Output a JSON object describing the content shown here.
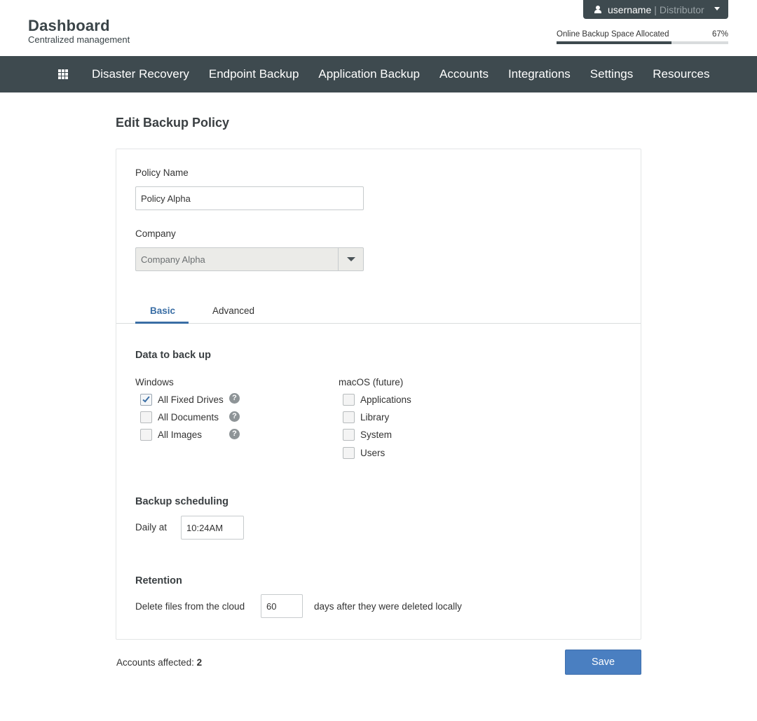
{
  "brand": {
    "title": "Dashboard",
    "subtitle": "Centralized management"
  },
  "user_menu": {
    "username": "username",
    "separator": "|",
    "role": "Distributor"
  },
  "quota": {
    "label": "Online Backup Space Allocated",
    "percent_text": "67%",
    "percent": 67
  },
  "nav": {
    "items": [
      "Disaster Recovery",
      "Endpoint Backup",
      "Application Backup",
      "Accounts",
      "Integrations",
      "Settings",
      "Resources"
    ]
  },
  "page": {
    "title": "Edit Backup Policy"
  },
  "form": {
    "policy_name_label": "Policy Name",
    "policy_name_value": "Policy Alpha",
    "company_label": "Company",
    "company_value": "Company Alpha"
  },
  "tabs": {
    "basic": "Basic",
    "advanced": "Advanced",
    "active": "basic"
  },
  "data_to_backup": {
    "heading": "Data to back up",
    "windows": {
      "label": "Windows",
      "options": [
        {
          "label": "All Fixed Drives",
          "checked": true,
          "help": "?"
        },
        {
          "label": "All Documents",
          "checked": false,
          "help": "?"
        },
        {
          "label": "All Images",
          "checked": false,
          "help": "?"
        }
      ]
    },
    "macos": {
      "label": "macOS (future)",
      "options": [
        {
          "label": "Applications",
          "checked": false
        },
        {
          "label": "Library",
          "checked": false
        },
        {
          "label": "System",
          "checked": false
        },
        {
          "label": "Users",
          "checked": false
        }
      ]
    }
  },
  "scheduling": {
    "heading": "Backup scheduling",
    "daily_label": "Daily at",
    "time_value": "10:24AM"
  },
  "retention": {
    "heading": "Retention",
    "prefix": "Delete files from the cloud",
    "days_value": "60",
    "suffix": "days after they were deleted locally"
  },
  "footer": {
    "accounts_label": "Accounts affected:",
    "accounts_count": "2",
    "save_label": "Save"
  }
}
